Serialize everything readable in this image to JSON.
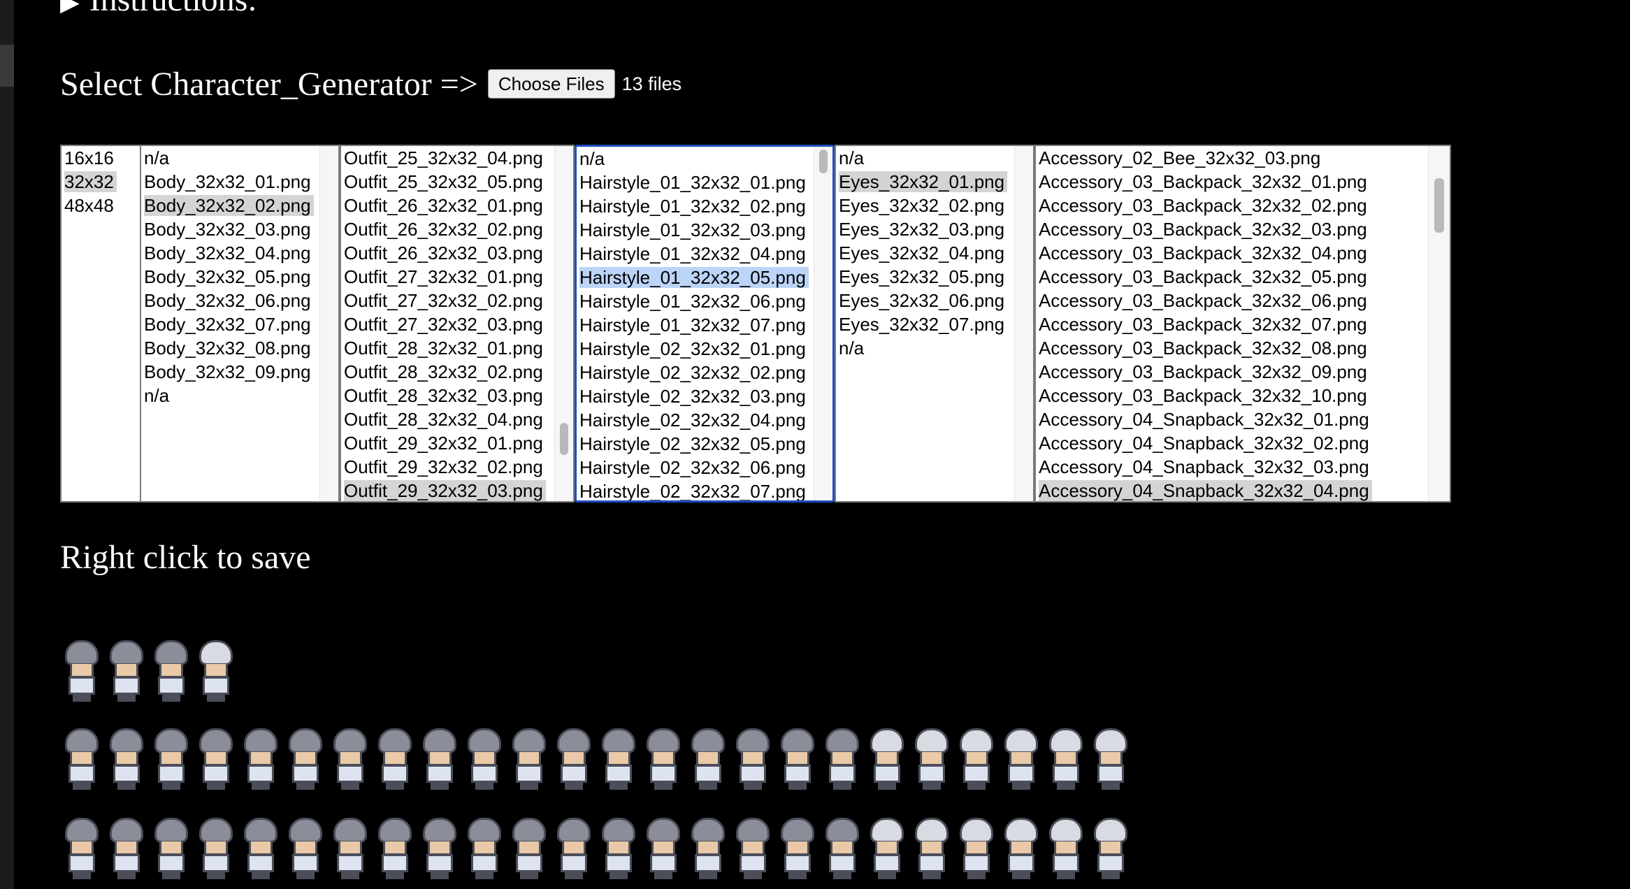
{
  "instructions": {
    "label": "Instructions:",
    "arrow": "▶"
  },
  "select": {
    "label": "Select Character_Generator =>",
    "button": "Choose Files",
    "file_count": "13 files"
  },
  "lists": {
    "size": {
      "options": [
        "16x16",
        "32x32",
        "48x48"
      ],
      "selected_index": 1
    },
    "body": {
      "options": [
        "n/a",
        "Body_32x32_01.png",
        "Body_32x32_02.png",
        "Body_32x32_03.png",
        "Body_32x32_04.png",
        "Body_32x32_05.png",
        "Body_32x32_06.png",
        "Body_32x32_07.png",
        "Body_32x32_08.png",
        "Body_32x32_09.png",
        "n/a"
      ],
      "selected_index": 2
    },
    "outfit": {
      "options": [
        "Outfit_25_32x32_04.png",
        "Outfit_25_32x32_05.png",
        "Outfit_26_32x32_01.png",
        "Outfit_26_32x32_02.png",
        "Outfit_26_32x32_03.png",
        "Outfit_27_32x32_01.png",
        "Outfit_27_32x32_02.png",
        "Outfit_27_32x32_03.png",
        "Outfit_28_32x32_01.png",
        "Outfit_28_32x32_02.png",
        "Outfit_28_32x32_03.png",
        "Outfit_28_32x32_04.png",
        "Outfit_29_32x32_01.png",
        "Outfit_29_32x32_02.png",
        "Outfit_29_32x32_03.png"
      ],
      "selected_index": 14
    },
    "hairstyle": {
      "options": [
        "n/a",
        "Hairstyle_01_32x32_01.png",
        "Hairstyle_01_32x32_02.png",
        "Hairstyle_01_32x32_03.png",
        "Hairstyle_01_32x32_04.png",
        "Hairstyle_01_32x32_05.png",
        "Hairstyle_01_32x32_06.png",
        "Hairstyle_01_32x32_07.png",
        "Hairstyle_02_32x32_01.png",
        "Hairstyle_02_32x32_02.png",
        "Hairstyle_02_32x32_03.png",
        "Hairstyle_02_32x32_04.png",
        "Hairstyle_02_32x32_05.png",
        "Hairstyle_02_32x32_06.png",
        "Hairstyle_02_32x32_07.png"
      ],
      "selected_index": 5
    },
    "eyes": {
      "options": [
        "n/a",
        "Eyes_32x32_01.png",
        "Eyes_32x32_02.png",
        "Eyes_32x32_03.png",
        "Eyes_32x32_04.png",
        "Eyes_32x32_05.png",
        "Eyes_32x32_06.png",
        "Eyes_32x32_07.png",
        "n/a"
      ],
      "selected_index": 1
    },
    "accessory": {
      "options": [
        "Accessory_02_Bee_32x32_03.png",
        "Accessory_03_Backpack_32x32_01.png",
        "Accessory_03_Backpack_32x32_02.png",
        "Accessory_03_Backpack_32x32_03.png",
        "Accessory_03_Backpack_32x32_04.png",
        "Accessory_03_Backpack_32x32_05.png",
        "Accessory_03_Backpack_32x32_06.png",
        "Accessory_03_Backpack_32x32_07.png",
        "Accessory_03_Backpack_32x32_08.png",
        "Accessory_03_Backpack_32x32_09.png",
        "Accessory_03_Backpack_32x32_10.png",
        "Accessory_04_Snapback_32x32_01.png",
        "Accessory_04_Snapback_32x32_02.png",
        "Accessory_04_Snapback_32x32_03.png",
        "Accessory_04_Snapback_32x32_04.png"
      ],
      "selected_index": 14
    }
  },
  "output": {
    "label": "Right click to save",
    "row_counts": [
      4,
      24,
      24
    ]
  },
  "colors": {
    "focus": "#1f4fbf",
    "selection_blue": "#bcd4f7",
    "selection_gray": "#d4d4d4",
    "background": "#000000"
  }
}
